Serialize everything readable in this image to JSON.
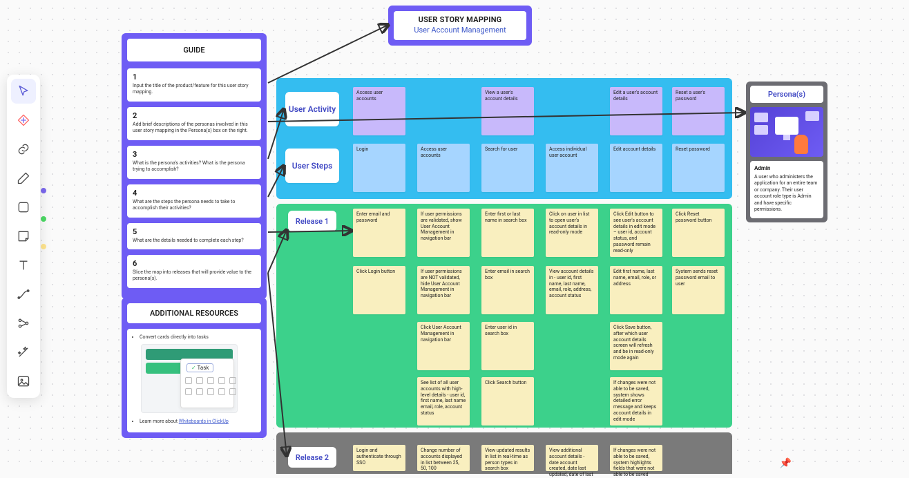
{
  "title": {
    "t1": "USER STORY MAPPING",
    "t2": "User Account Management"
  },
  "guide": {
    "header": "GUIDE",
    "steps": [
      {
        "num": "1",
        "txt": "Input the title of the product/feature for this user story mapping."
      },
      {
        "num": "2",
        "txt": "Add brief descriptions of the personas involved in this user story mapping in the Persona(s) box on the right."
      },
      {
        "num": "3",
        "txt": "What is the persona's activities? What is the persona trying to accomplish?"
      },
      {
        "num": "4",
        "txt": "What are the steps the persona needs to take to accomplish their activities?"
      },
      {
        "num": "5",
        "txt": "What are the details needed to complete each step?"
      },
      {
        "num": "6",
        "txt": "Slice the map into releases that will provide value to the persona(s)."
      }
    ]
  },
  "resources": {
    "header": "ADDITIONAL RESOURCES",
    "items": [
      "Convert cards directly into tasks",
      "Learn more about "
    ],
    "link": "Whiteboards in ClickUp"
  },
  "sections": {
    "userActivity": "User Activity",
    "userSteps": "User Steps",
    "release1": "Release 1",
    "release2": "Release 2"
  },
  "activities": [
    "Access user accounts",
    "View a user's account details",
    "Edit a user's account details",
    "Reset a user's password"
  ],
  "steps": [
    "Login",
    "Access user accounts",
    "Search for user",
    "Access individual user account",
    "Edit account details",
    "Reset password"
  ],
  "release1": {
    "row1": [
      "Enter email and password",
      "If user permissions are validated, show User Account Management in navigation bar",
      "Enter first or last name in search box",
      "Click on user in list to open user's account details in read-only mode",
      "Click Edit button to see user's account details in edit mode – user id, account status, and password remain read-only",
      "Click Reset password button"
    ],
    "row2": [
      "Click Login button",
      "If user permissions are NOT validated, hide User Account Management in navigation bar",
      "Enter email in search box",
      "View account details in - user id, first name, last name, email, role, address, account status",
      "Edit first name, last name, email, role, or address",
      "System sends reset password email to user"
    ],
    "row3": [
      "",
      "Click User Account Management in navigation bar",
      "Enter user id in search box",
      "",
      "Click Save button, after which user account details screen will refresh and be in read-only mode again",
      ""
    ],
    "row4": [
      "",
      "See list of all user accounts with high-level details - user id, first name, last name email, role, account status",
      "Click Search button",
      "",
      "If changes were not able to be saved, system shows detailed error message and keeps account details in edit mode",
      ""
    ]
  },
  "release2": {
    "row1": [
      "Login and authenticate through SSO",
      "Change number of accounts displayed in list between 25, 50, 100",
      "View updated results in list in real-time as person types in search box",
      "View additional account details - date account created, date last updated, date of last",
      "If changes were not able to be saved, system highlights fields that were not able to be saved"
    ]
  },
  "persona": {
    "header": "Persona(s)",
    "name": "Admin",
    "desc": "A user who administers the application for an entire team or company. Their user account role type is Admin and have specific permissions."
  },
  "pin": "📌"
}
